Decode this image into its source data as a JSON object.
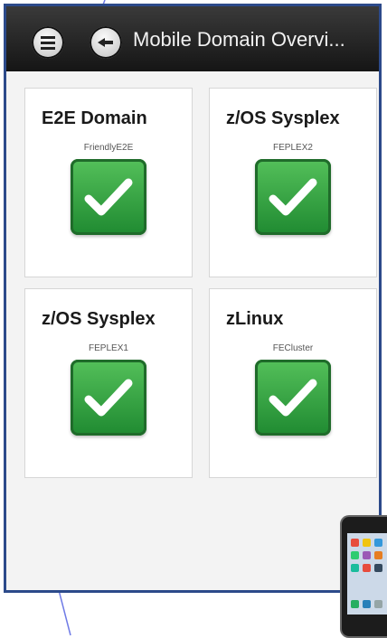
{
  "header": {
    "title": "Mobile Domain Overvi...",
    "menu_icon": "menu-icon",
    "back_icon": "back-icon"
  },
  "cards": [
    {
      "name": "E2E Domain",
      "subtitle": "FriendlyE2E",
      "status": "ok"
    },
    {
      "name": "z/OS Sysplex",
      "subtitle": "FEPLEX2",
      "status": "ok"
    },
    {
      "name": "z/OS Sysplex",
      "subtitle": "FEPLEX1",
      "status": "ok"
    },
    {
      "name": "zLinux",
      "subtitle": "FECluster",
      "status": "ok"
    }
  ],
  "colors": {
    "status_ok": "#2e9e3e",
    "topbar": "#1c1c1c",
    "frame": "#2c4a8a"
  }
}
